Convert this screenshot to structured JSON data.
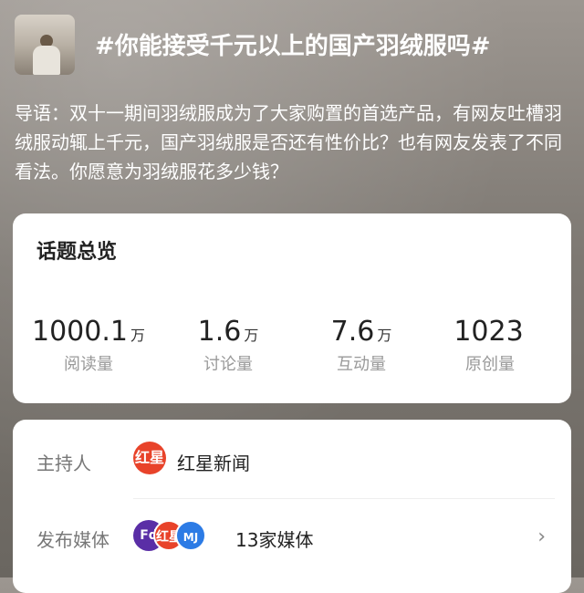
{
  "header": {
    "title": "#你能接受千元以上的国产羽绒服吗#",
    "intro": "导语：双十一期间羽绒服成为了大家购置的首选产品，有网友吐槽羽绒服动辄上千元，国产羽绒服是否还有性价比？也有网友发表了不同看法。你愿意为羽绒服花多少钱？"
  },
  "overview": {
    "title": "话题总览",
    "stats": [
      {
        "value": "1000.1",
        "unit": "万",
        "label": "阅读量"
      },
      {
        "value": "1.6",
        "unit": "万",
        "label": "讨论量"
      },
      {
        "value": "7.6",
        "unit": "万",
        "label": "互动量"
      },
      {
        "value": "1023",
        "unit": "",
        "label": "原创量"
      }
    ]
  },
  "info": {
    "host_label": "主持人",
    "host_name": "红星新闻",
    "host_logo_text": "红星",
    "media_label": "发布媒体",
    "media_count": "13家媒体",
    "media_logos": [
      "Fd",
      "红星",
      "MJ"
    ]
  },
  "colors": {
    "accent_red": "#e8432a",
    "card_bg": "#ffffff"
  },
  "icons": {
    "chevron": "chevron-right-icon"
  }
}
